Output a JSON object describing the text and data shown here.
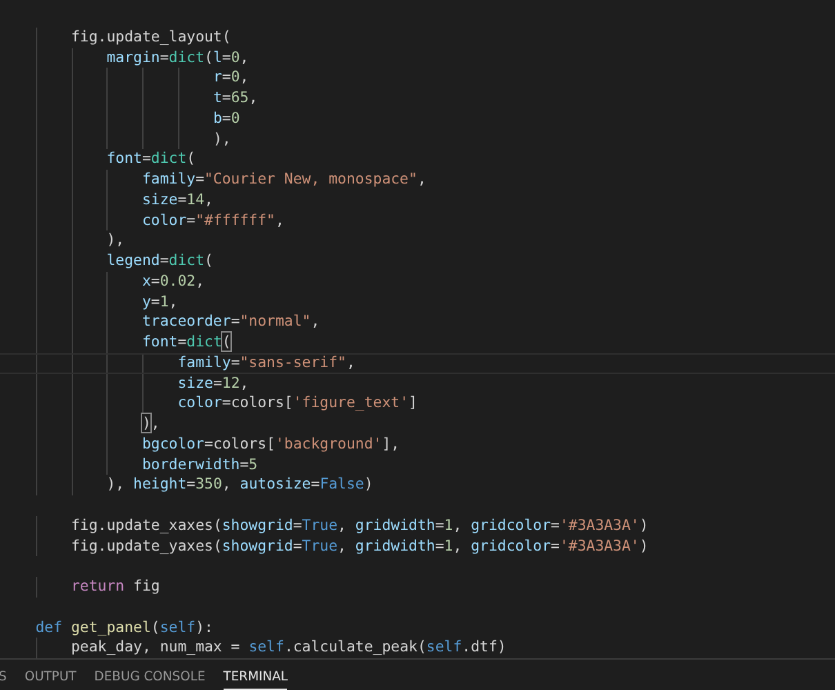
{
  "editor": {
    "lines": [
      {
        "kind": "blank",
        "current": false
      },
      {
        "kind": "code",
        "current": false,
        "tokens": [
          {
            "text": "        fig.update_layout",
            "kind": "plain"
          },
          {
            "text": "(",
            "kind": "punct"
          }
        ]
      },
      {
        "kind": "code",
        "current": false,
        "tokens": [
          {
            "text": "            margin",
            "kind": "param"
          },
          {
            "text": "=",
            "kind": "punct"
          },
          {
            "text": "dict",
            "kind": "type"
          },
          {
            "text": "(",
            "kind": "punct"
          },
          {
            "text": "l",
            "kind": "param"
          },
          {
            "text": "=",
            "kind": "punct"
          },
          {
            "text": "0",
            "kind": "number"
          },
          {
            "text": ",",
            "kind": "punct"
          }
        ]
      },
      {
        "kind": "code",
        "current": false,
        "tokens": [
          {
            "text": "                        r",
            "kind": "param"
          },
          {
            "text": "=",
            "kind": "punct"
          },
          {
            "text": "0",
            "kind": "number"
          },
          {
            "text": ",",
            "kind": "punct"
          }
        ]
      },
      {
        "kind": "code",
        "current": false,
        "tokens": [
          {
            "text": "                        t",
            "kind": "param"
          },
          {
            "text": "=",
            "kind": "punct"
          },
          {
            "text": "65",
            "kind": "number"
          },
          {
            "text": ",",
            "kind": "punct"
          }
        ]
      },
      {
        "kind": "code",
        "current": false,
        "tokens": [
          {
            "text": "                        b",
            "kind": "param"
          },
          {
            "text": "=",
            "kind": "punct"
          },
          {
            "text": "0",
            "kind": "number"
          }
        ]
      },
      {
        "kind": "code",
        "current": false,
        "tokens": [
          {
            "text": "                        ),",
            "kind": "punct"
          }
        ]
      },
      {
        "kind": "code",
        "current": false,
        "tokens": [
          {
            "text": "            font",
            "kind": "param"
          },
          {
            "text": "=",
            "kind": "punct"
          },
          {
            "text": "dict",
            "kind": "type"
          },
          {
            "text": "(",
            "kind": "punct"
          }
        ]
      },
      {
        "kind": "code",
        "current": false,
        "tokens": [
          {
            "text": "                family",
            "kind": "param"
          },
          {
            "text": "=",
            "kind": "punct"
          },
          {
            "text": "\"Courier New, monospace\"",
            "kind": "string"
          },
          {
            "text": ",",
            "kind": "punct"
          }
        ]
      },
      {
        "kind": "code",
        "current": false,
        "tokens": [
          {
            "text": "                size",
            "kind": "param"
          },
          {
            "text": "=",
            "kind": "punct"
          },
          {
            "text": "14",
            "kind": "number"
          },
          {
            "text": ",",
            "kind": "punct"
          }
        ]
      },
      {
        "kind": "code",
        "current": false,
        "tokens": [
          {
            "text": "                color",
            "kind": "param"
          },
          {
            "text": "=",
            "kind": "punct"
          },
          {
            "text": "\"#ffffff\"",
            "kind": "string"
          },
          {
            "text": ",",
            "kind": "punct"
          }
        ]
      },
      {
        "kind": "code",
        "current": false,
        "tokens": [
          {
            "text": "            ),",
            "kind": "punct"
          }
        ]
      },
      {
        "kind": "code",
        "current": false,
        "tokens": [
          {
            "text": "            legend",
            "kind": "param"
          },
          {
            "text": "=",
            "kind": "punct"
          },
          {
            "text": "dict",
            "kind": "type"
          },
          {
            "text": "(",
            "kind": "punct"
          }
        ]
      },
      {
        "kind": "code",
        "current": false,
        "tokens": [
          {
            "text": "                x",
            "kind": "param"
          },
          {
            "text": "=",
            "kind": "punct"
          },
          {
            "text": "0.02",
            "kind": "number"
          },
          {
            "text": ",",
            "kind": "punct"
          }
        ]
      },
      {
        "kind": "code",
        "current": false,
        "tokens": [
          {
            "text": "                y",
            "kind": "param"
          },
          {
            "text": "=",
            "kind": "punct"
          },
          {
            "text": "1",
            "kind": "number"
          },
          {
            "text": ",",
            "kind": "punct"
          }
        ]
      },
      {
        "kind": "code",
        "current": false,
        "tokens": [
          {
            "text": "                traceorder",
            "kind": "param"
          },
          {
            "text": "=",
            "kind": "punct"
          },
          {
            "text": "\"normal\"",
            "kind": "string"
          },
          {
            "text": ",",
            "kind": "punct"
          }
        ]
      },
      {
        "kind": "code",
        "current": false,
        "tokens": [
          {
            "text": "                font",
            "kind": "param"
          },
          {
            "text": "=",
            "kind": "punct"
          },
          {
            "text": "dict",
            "kind": "type"
          },
          {
            "text": "(",
            "kind": "match"
          }
        ]
      },
      {
        "kind": "code",
        "current": true,
        "tokens": [
          {
            "text": "                    family",
            "kind": "param"
          },
          {
            "text": "=",
            "kind": "punct"
          },
          {
            "text": "\"sans-serif\"",
            "kind": "string"
          },
          {
            "text": ",",
            "kind": "punct"
          }
        ]
      },
      {
        "kind": "code",
        "current": false,
        "tokens": [
          {
            "text": "                    size",
            "kind": "param"
          },
          {
            "text": "=",
            "kind": "punct"
          },
          {
            "text": "12",
            "kind": "number"
          },
          {
            "text": ",",
            "kind": "punct"
          }
        ]
      },
      {
        "kind": "code",
        "current": false,
        "tokens": [
          {
            "text": "                    color",
            "kind": "param"
          },
          {
            "text": "=",
            "kind": "punct"
          },
          {
            "text": "colors[",
            "kind": "plain"
          },
          {
            "text": "'figure_text'",
            "kind": "string"
          },
          {
            "text": "]",
            "kind": "punct"
          }
        ]
      },
      {
        "kind": "code",
        "current": false,
        "tokens": [
          {
            "text": "                )",
            "kind": "match"
          },
          {
            "text": ",",
            "kind": "punct"
          }
        ]
      },
      {
        "kind": "code",
        "current": false,
        "tokens": [
          {
            "text": "                bgcolor",
            "kind": "param"
          },
          {
            "text": "=",
            "kind": "punct"
          },
          {
            "text": "colors[",
            "kind": "plain"
          },
          {
            "text": "'background'",
            "kind": "string"
          },
          {
            "text": "],",
            "kind": "punct"
          }
        ]
      },
      {
        "kind": "code",
        "current": false,
        "tokens": [
          {
            "text": "                borderwidth",
            "kind": "param"
          },
          {
            "text": "=",
            "kind": "punct"
          },
          {
            "text": "5",
            "kind": "number"
          }
        ]
      },
      {
        "kind": "code",
        "current": false,
        "tokens": [
          {
            "text": "            ), ",
            "kind": "punct"
          },
          {
            "text": "height",
            "kind": "param"
          },
          {
            "text": "=",
            "kind": "punct"
          },
          {
            "text": "350",
            "kind": "number"
          },
          {
            "text": ", ",
            "kind": "punct"
          },
          {
            "text": "autosize",
            "kind": "param"
          },
          {
            "text": "=",
            "kind": "punct"
          },
          {
            "text": "False",
            "kind": "keyword"
          },
          {
            "text": ")",
            "kind": "punct"
          }
        ]
      },
      {
        "kind": "blank",
        "current": false
      },
      {
        "kind": "code",
        "current": false,
        "tokens": [
          {
            "text": "        fig.update_xaxes",
            "kind": "plain"
          },
          {
            "text": "(",
            "kind": "punct"
          },
          {
            "text": "showgrid",
            "kind": "param"
          },
          {
            "text": "=",
            "kind": "punct"
          },
          {
            "text": "True",
            "kind": "keyword"
          },
          {
            "text": ", ",
            "kind": "punct"
          },
          {
            "text": "gridwidth",
            "kind": "param"
          },
          {
            "text": "=",
            "kind": "punct"
          },
          {
            "text": "1",
            "kind": "number"
          },
          {
            "text": ", ",
            "kind": "punct"
          },
          {
            "text": "gridcolor",
            "kind": "param"
          },
          {
            "text": "=",
            "kind": "punct"
          },
          {
            "text": "'#3A3A3A'",
            "kind": "string"
          },
          {
            "text": ")",
            "kind": "punct"
          }
        ]
      },
      {
        "kind": "code",
        "current": false,
        "tokens": [
          {
            "text": "        fig.update_yaxes",
            "kind": "plain"
          },
          {
            "text": "(",
            "kind": "punct"
          },
          {
            "text": "showgrid",
            "kind": "param"
          },
          {
            "text": "=",
            "kind": "punct"
          },
          {
            "text": "True",
            "kind": "keyword"
          },
          {
            "text": ", ",
            "kind": "punct"
          },
          {
            "text": "gridwidth",
            "kind": "param"
          },
          {
            "text": "=",
            "kind": "punct"
          },
          {
            "text": "1",
            "kind": "number"
          },
          {
            "text": ", ",
            "kind": "punct"
          },
          {
            "text": "gridcolor",
            "kind": "param"
          },
          {
            "text": "=",
            "kind": "punct"
          },
          {
            "text": "'#3A3A3A'",
            "kind": "string"
          },
          {
            "text": ")",
            "kind": "punct"
          }
        ]
      },
      {
        "kind": "blank",
        "current": false
      },
      {
        "kind": "code",
        "current": false,
        "tokens": [
          {
            "text": "        return",
            "kind": "control"
          },
          {
            "text": " fig",
            "kind": "plain"
          }
        ]
      },
      {
        "kind": "blank",
        "current": false
      },
      {
        "kind": "code",
        "current": false,
        "tokens": [
          {
            "text": "    def",
            "kind": "keyword"
          },
          {
            "text": " get_panel",
            "kind": "function"
          },
          {
            "text": "(",
            "kind": "punct"
          },
          {
            "text": "self",
            "kind": "keyword"
          },
          {
            "text": "):",
            "kind": "punct"
          }
        ]
      },
      {
        "kind": "code",
        "current": false,
        "tokens": [
          {
            "text": "        peak_day, num_max = ",
            "kind": "plain"
          },
          {
            "text": "self",
            "kind": "keyword"
          },
          {
            "text": ".calculate_peak(",
            "kind": "plain"
          },
          {
            "text": "self",
            "kind": "keyword"
          },
          {
            "text": ".dtf)",
            "kind": "plain"
          }
        ]
      }
    ]
  },
  "panel": {
    "tabs": [
      {
        "label": "S",
        "selected": false
      },
      {
        "label": "OUTPUT",
        "selected": false
      },
      {
        "label": "DEBUG CONSOLE",
        "selected": false
      },
      {
        "label": "TERMINAL",
        "selected": true
      }
    ]
  }
}
